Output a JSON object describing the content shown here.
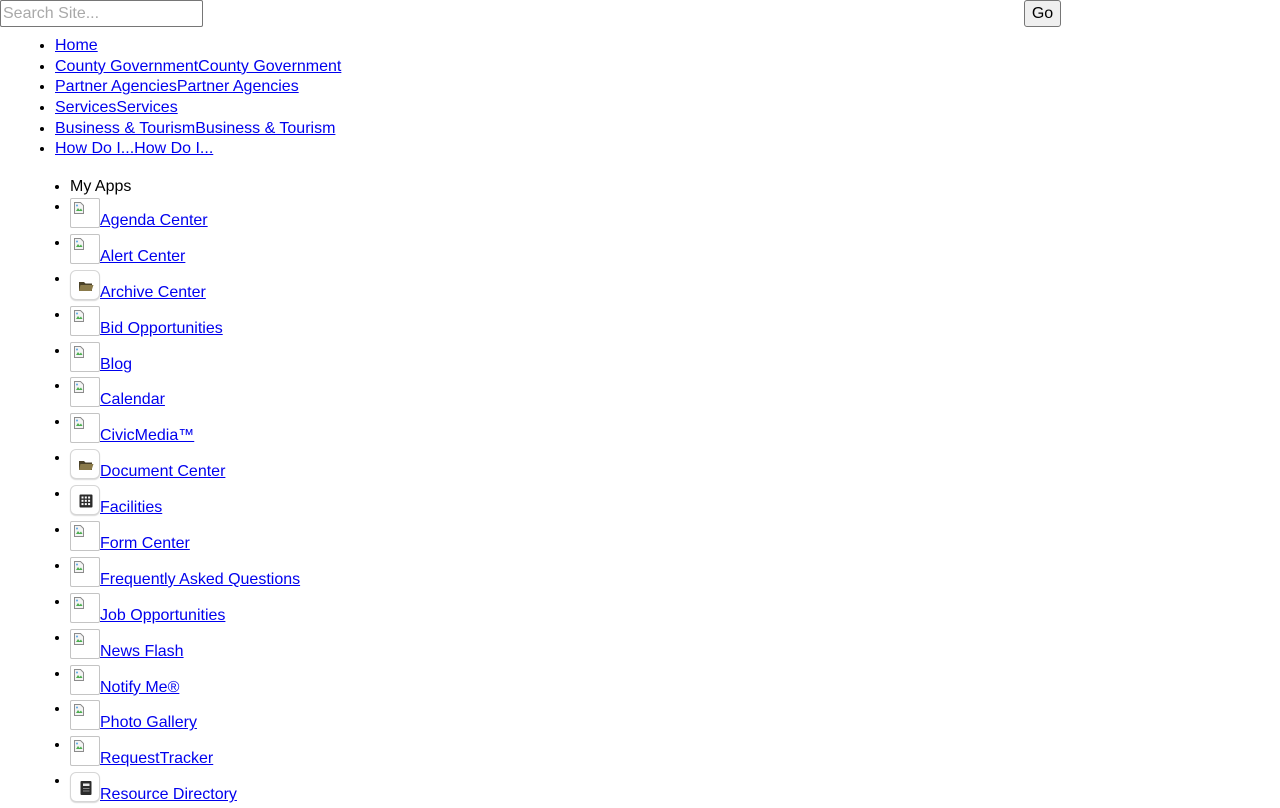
{
  "search": {
    "placeholder": "Search Site...",
    "go_label": "Go"
  },
  "nav": {
    "items": [
      {
        "label": "Home"
      },
      {
        "label": "County GovernmentCounty Government"
      },
      {
        "label": "Partner AgenciesPartner Agencies"
      },
      {
        "label": "ServicesServices"
      },
      {
        "label": "Business & TourismBusiness & Tourism"
      },
      {
        "label": "How Do I...How Do I..."
      }
    ]
  },
  "apps": {
    "header": "My Apps",
    "items": [
      {
        "label": "Agenda Center",
        "icon": "broken-image-icon"
      },
      {
        "label": "Alert Center",
        "icon": "broken-image-icon"
      },
      {
        "label": "Archive Center",
        "icon": "folder-icon"
      },
      {
        "label": "Bid Opportunities",
        "icon": "broken-image-icon"
      },
      {
        "label": "Blog",
        "icon": "broken-image-icon"
      },
      {
        "label": "Calendar",
        "icon": "broken-image-icon"
      },
      {
        "label": "CivicMedia™",
        "icon": "broken-image-icon"
      },
      {
        "label": "Document Center",
        "icon": "folder-icon"
      },
      {
        "label": "Facilities",
        "icon": "building-icon"
      },
      {
        "label": "Form Center",
        "icon": "broken-image-icon"
      },
      {
        "label": "Frequently Asked Questions",
        "icon": "broken-image-icon"
      },
      {
        "label": "Job Opportunities",
        "icon": "broken-image-icon"
      },
      {
        "label": "News Flash",
        "icon": "broken-image-icon"
      },
      {
        "label": "Notify Me®",
        "icon": "broken-image-icon"
      },
      {
        "label": "Photo Gallery",
        "icon": "broken-image-icon"
      },
      {
        "label": "RequestTracker",
        "icon": "broken-image-icon"
      },
      {
        "label": "Resource Directory",
        "icon": "directory-book-icon"
      }
    ]
  },
  "colors": {
    "link": "#0000ee",
    "folder": "#6b5e3a"
  }
}
